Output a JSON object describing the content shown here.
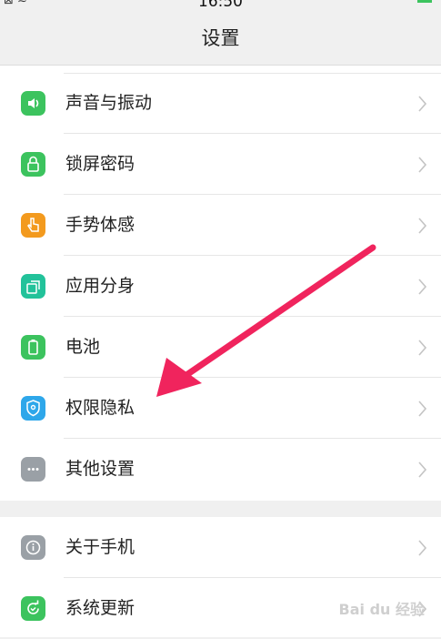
{
  "status": {
    "time": "16:50"
  },
  "header": {
    "title": "设置"
  },
  "settings_group_1": [
    {
      "label": "声音与振动",
      "icon": "speaker-icon",
      "color": "#3cc35e"
    },
    {
      "label": "锁屏密码",
      "icon": "lock-icon",
      "color": "#3cc35e"
    },
    {
      "label": "手势体感",
      "icon": "hand-gesture-icon",
      "color": "#f39a1e"
    },
    {
      "label": "应用分身",
      "icon": "app-clone-icon",
      "color": "#22c29a"
    },
    {
      "label": "电池",
      "icon": "battery-icon",
      "color": "#3cc35e"
    },
    {
      "label": "权限隐私",
      "icon": "shield-icon",
      "color": "#2ea7ea"
    },
    {
      "label": "其他设置",
      "icon": "more-dots-icon",
      "color": "#9aa0a6"
    }
  ],
  "settings_group_2": [
    {
      "label": "关于手机",
      "icon": "info-icon",
      "color": "#9aa0a6"
    },
    {
      "label": "系统更新",
      "icon": "update-icon",
      "color": "#3cc35e"
    }
  ],
  "annotation": {
    "arrow_color": "#f0245d",
    "points_to": "权限隐私"
  }
}
